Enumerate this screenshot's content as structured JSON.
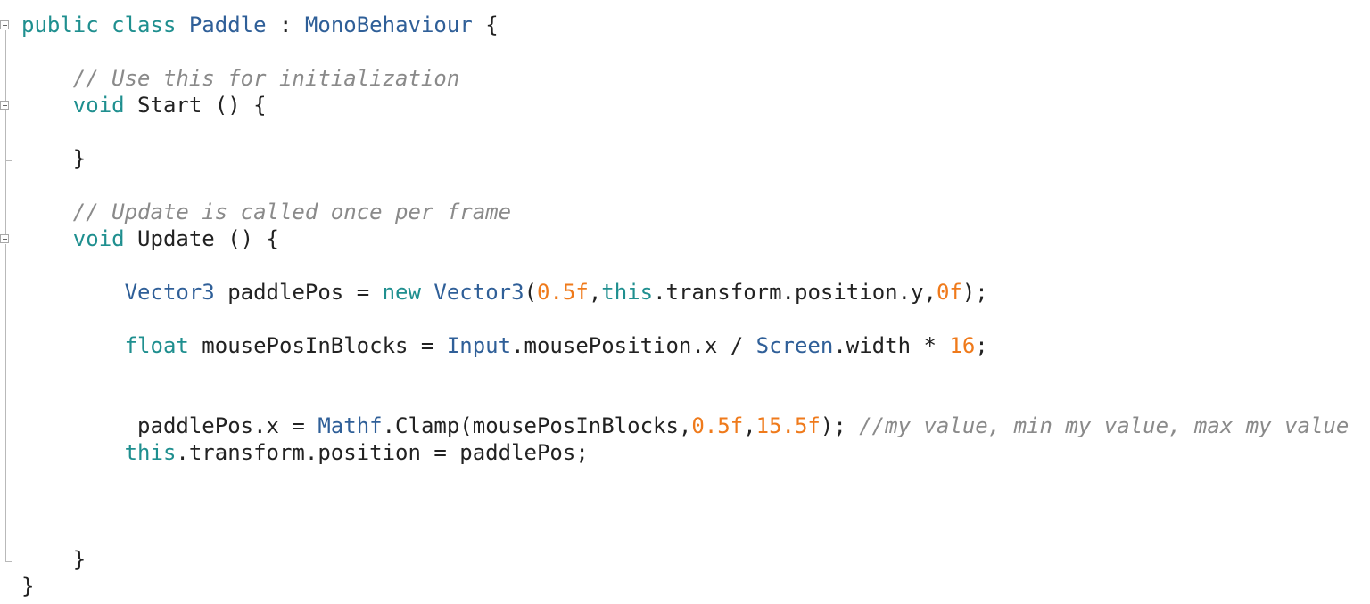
{
  "editor": {
    "language": "csharp",
    "lines": [
      [
        {
          "t": "public",
          "c": "kw"
        },
        {
          "t": " ",
          "c": "pl"
        },
        {
          "t": "class",
          "c": "kw"
        },
        {
          "t": " ",
          "c": "pl"
        },
        {
          "t": "Paddle",
          "c": "ty"
        },
        {
          "t": " : ",
          "c": "pl"
        },
        {
          "t": "MonoBehaviour",
          "c": "ty"
        },
        {
          "t": " {",
          "c": "pl"
        }
      ],
      [],
      [
        {
          "t": "    ",
          "c": "pl"
        },
        {
          "t": "// Use this for initialization",
          "c": "cm"
        }
      ],
      [
        {
          "t": "    ",
          "c": "pl"
        },
        {
          "t": "void",
          "c": "kw"
        },
        {
          "t": " Start () {",
          "c": "pl"
        }
      ],
      [],
      [
        {
          "t": "    }",
          "c": "pl"
        }
      ],
      [],
      [
        {
          "t": "    ",
          "c": "pl"
        },
        {
          "t": "// Update is called once per frame",
          "c": "cm"
        }
      ],
      [
        {
          "t": "    ",
          "c": "pl"
        },
        {
          "t": "void",
          "c": "kw"
        },
        {
          "t": " Update () {",
          "c": "pl"
        }
      ],
      [],
      [
        {
          "t": "        ",
          "c": "pl"
        },
        {
          "t": "Vector3",
          "c": "ty"
        },
        {
          "t": " paddlePos = ",
          "c": "pl"
        },
        {
          "t": "new",
          "c": "kw"
        },
        {
          "t": " ",
          "c": "pl"
        },
        {
          "t": "Vector3",
          "c": "ty"
        },
        {
          "t": "(",
          "c": "pl"
        },
        {
          "t": "0.5f",
          "c": "num"
        },
        {
          "t": ",",
          "c": "pl"
        },
        {
          "t": "this",
          "c": "kw"
        },
        {
          "t": ".transform.position.y,",
          "c": "pl"
        },
        {
          "t": "0f",
          "c": "num"
        },
        {
          "t": ");",
          "c": "pl"
        }
      ],
      [],
      [
        {
          "t": "        ",
          "c": "pl"
        },
        {
          "t": "float",
          "c": "kw"
        },
        {
          "t": " mousePosInBlocks = ",
          "c": "pl"
        },
        {
          "t": "Input",
          "c": "ty"
        },
        {
          "t": ".mousePosition.x / ",
          "c": "pl"
        },
        {
          "t": "Screen",
          "c": "ty"
        },
        {
          "t": ".width * ",
          "c": "pl"
        },
        {
          "t": "16",
          "c": "num"
        },
        {
          "t": ";",
          "c": "pl"
        }
      ],
      [],
      [],
      [
        {
          "t": "         paddlePos.x = ",
          "c": "pl"
        },
        {
          "t": "Mathf",
          "c": "ty"
        },
        {
          "t": ".Clamp(mousePosInBlocks,",
          "c": "pl"
        },
        {
          "t": "0.5f",
          "c": "num"
        },
        {
          "t": ",",
          "c": "pl"
        },
        {
          "t": "15.5f",
          "c": "num"
        },
        {
          "t": "); ",
          "c": "pl"
        },
        {
          "t": "//my value, min my value, max my value",
          "c": "cm"
        }
      ],
      [
        {
          "t": "        ",
          "c": "pl"
        },
        {
          "t": "this",
          "c": "kw"
        },
        {
          "t": ".transform.position = paddlePos;",
          "c": "pl"
        }
      ],
      [],
      [],
      [],
      [
        {
          "t": "    }",
          "c": "pl"
        }
      ],
      [
        {
          "t": "}",
          "c": "pl"
        }
      ]
    ]
  },
  "colors": {
    "keyword": "#1f8f8f",
    "type": "#2f5f98",
    "number": "#ef7a1b",
    "comment": "#8a8a8a",
    "plain": "#222222",
    "background": "#ffffff"
  }
}
